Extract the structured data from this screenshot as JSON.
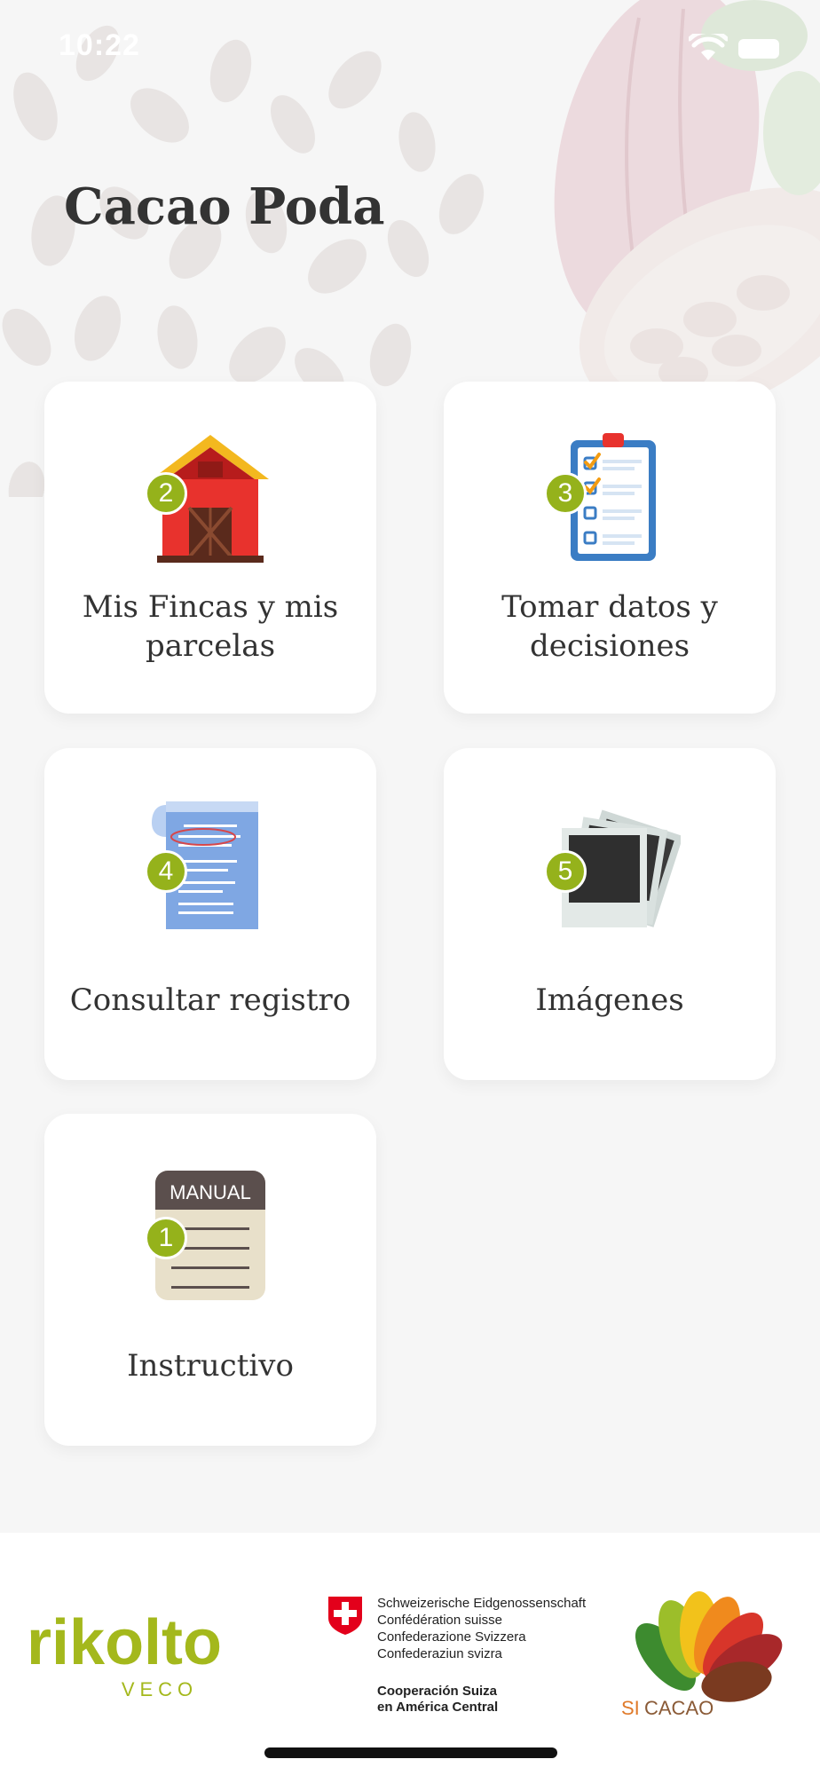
{
  "status_bar": {
    "time": "10:22",
    "icons": [
      "wifi-icon",
      "battery-icon"
    ]
  },
  "header": {
    "title": "Cacao Poda"
  },
  "menu": {
    "cards": [
      {
        "label": "Mis Fincas y mis parcelas",
        "badge": "2",
        "icon": "barn-icon"
      },
      {
        "label": "Tomar datos y decisiones",
        "badge": "3",
        "icon": "clipboard-checklist-icon"
      },
      {
        "label": "Consultar registro",
        "badge": "4",
        "icon": "document-scroll-icon"
      },
      {
        "label": "Imágenes",
        "badge": "5",
        "icon": "photos-icon"
      },
      {
        "label": "Instructivo",
        "badge": "1",
        "icon": "manual-icon",
        "icon_text": "MANUAL"
      }
    ]
  },
  "footer": {
    "rikolto": {
      "name": "rikolto",
      "sub": "VECO"
    },
    "swiss": {
      "lines": [
        "Schweizerische Eidgenossenschaft",
        "Confédération suisse",
        "Confederazione Svizzera",
        "Confederaziun svizra"
      ],
      "cooperation": [
        "Cooperación Suiza",
        "en América Central"
      ]
    },
    "sicacao": {
      "name_si": "SI",
      "name_cacao": "CACAO"
    }
  },
  "colors": {
    "badge_green": "#95b21b",
    "rikolto_green": "#a4b81c",
    "sicacao_orange": "#e07a2a",
    "swiss_red": "#e3001b"
  }
}
